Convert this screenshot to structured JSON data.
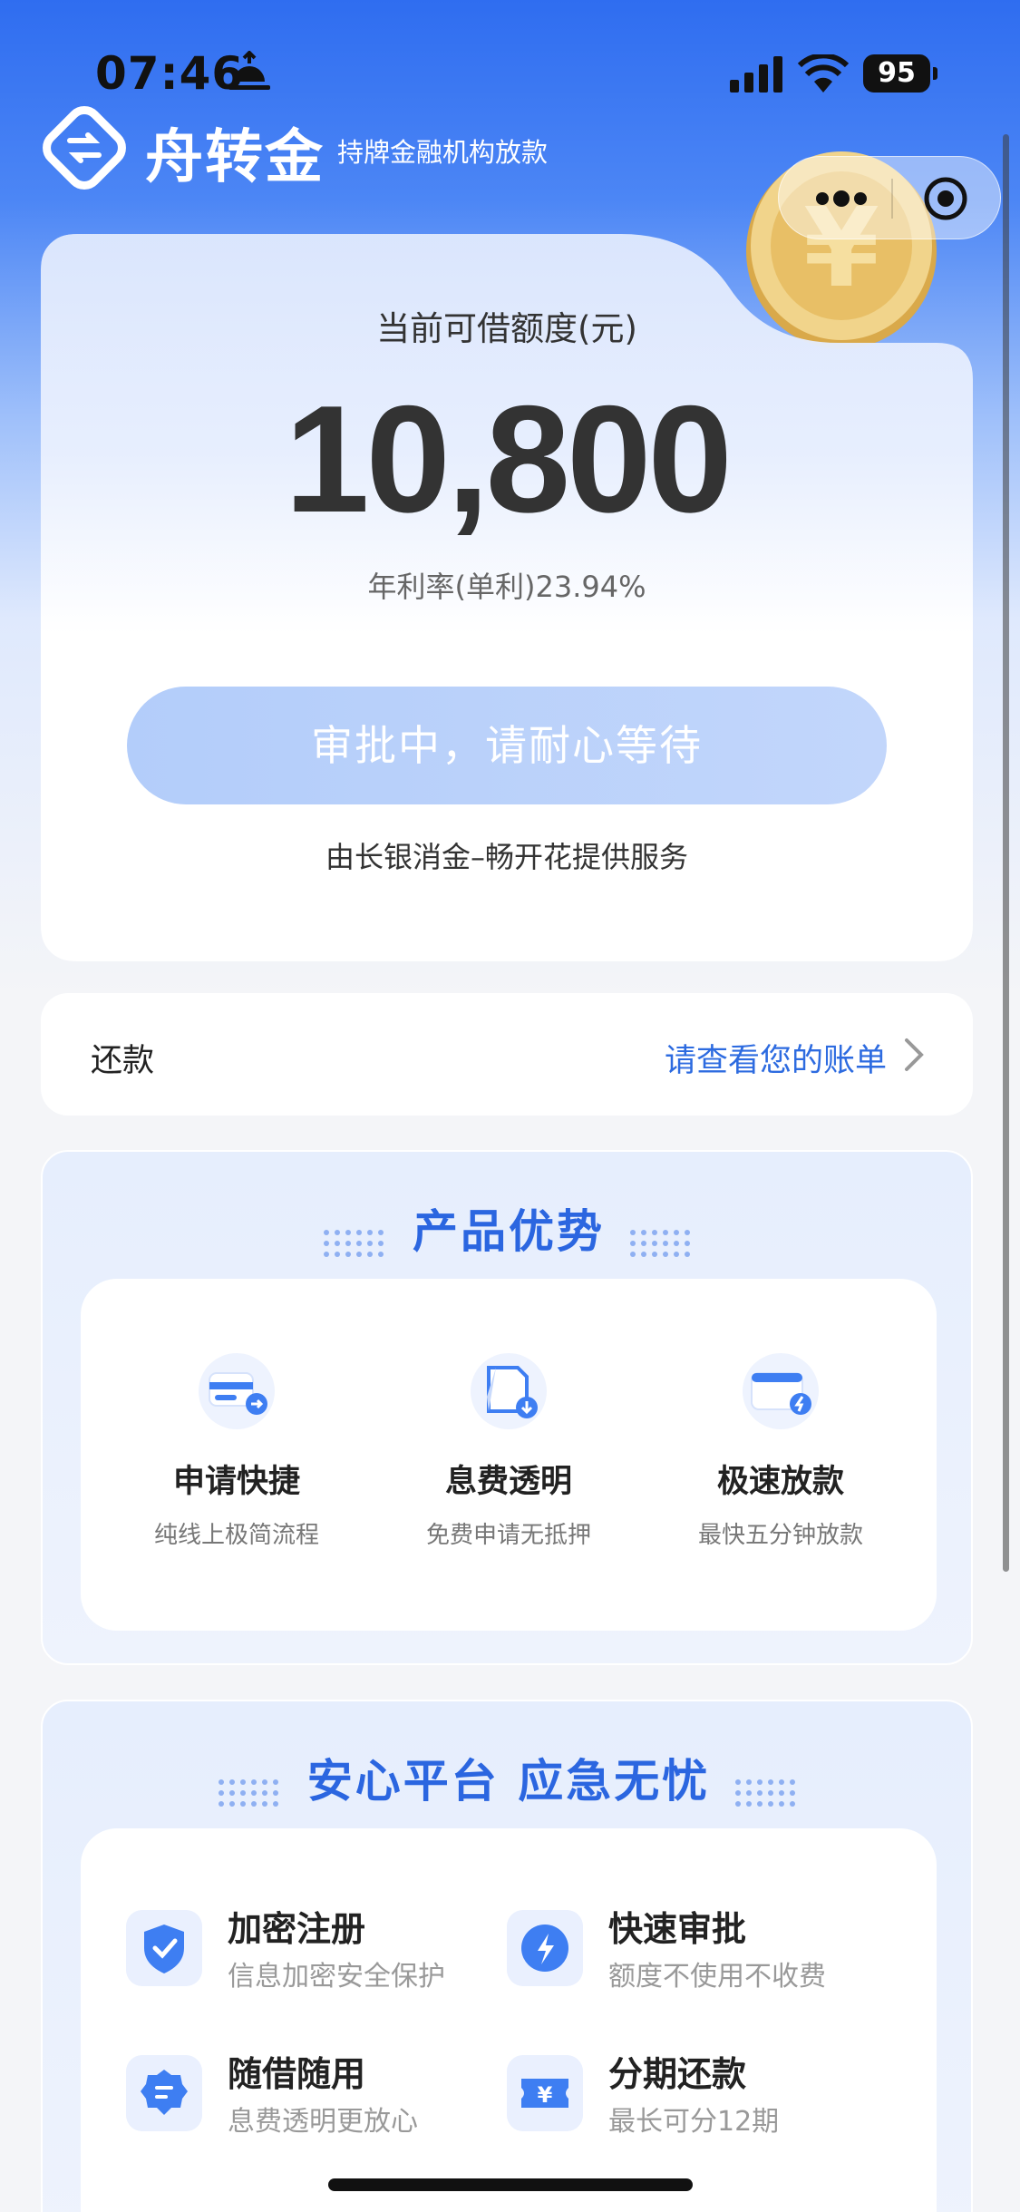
{
  "status_bar": {
    "time": "07:46",
    "battery": "95"
  },
  "header": {
    "brand": "舟转金",
    "tagline": "持牌金融机构放款"
  },
  "quota": {
    "label": "当前可借额度(元)",
    "amount": "10,800",
    "rate": "年利率(单利)23.94%",
    "button": "审批中，请耐心等待",
    "service": "由长银消金–畅开花提供服务"
  },
  "repay": {
    "label": "还款",
    "link": "请查看您的账单"
  },
  "advantages": {
    "title": "产品优势",
    "items": [
      {
        "title": "申请快捷",
        "desc": "纯线上极简流程",
        "icon": "card-arrow-icon"
      },
      {
        "title": "息费透明",
        "desc": "免费申请无抵押",
        "icon": "document-icon"
      },
      {
        "title": "极速放款",
        "desc": "最快五分钟放款",
        "icon": "wallet-icon"
      }
    ]
  },
  "platform": {
    "title": "安心平台 应急无忧",
    "items": [
      {
        "title": "加密注册",
        "desc": "信息加密安全保护",
        "icon": "shield-check-icon"
      },
      {
        "title": "快速审批",
        "desc": "额度不使用不收费",
        "icon": "lightning-icon"
      },
      {
        "title": "随借随用",
        "desc": "息费透明更放心",
        "icon": "badge-icon"
      },
      {
        "title": "分期还款",
        "desc": "最长可分12期",
        "icon": "yuan-ticket-icon"
      }
    ]
  },
  "colors": {
    "primary": "#2b66e0",
    "button": "#b3cdfa"
  }
}
